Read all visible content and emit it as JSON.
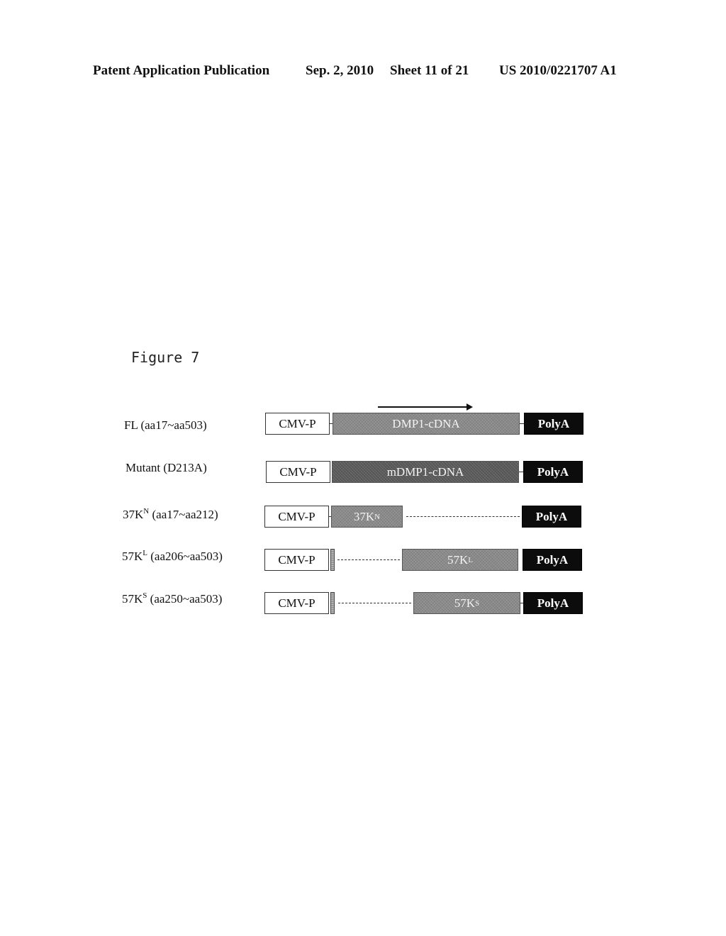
{
  "header": {
    "publication": "Patent Application Publication",
    "date": "Sep. 2, 2010",
    "sheet": "Sheet 11 of 21",
    "number": "US 2010/0221707 A1"
  },
  "figure": {
    "title": "Figure 7",
    "constructs": [
      {
        "name": "FL",
        "label_main": "FL (aa17~aa503)",
        "promoter": "CMV-P",
        "insert": "DMP1-cDNA",
        "insert_sup": "",
        "polya": "PolyA",
        "has_arrow": true
      },
      {
        "name": "Mutant",
        "label_main": "Mutant (D213A)",
        "promoter": "CMV-P",
        "insert": "mDMP1-cDNA",
        "insert_sup": "",
        "polya": "PolyA"
      },
      {
        "name": "37KN",
        "label_base": "37K",
        "label_sup": "N",
        "label_range": " (aa17~aa212)",
        "promoter": "CMV-P",
        "insert_base": "37K",
        "insert_sup": "N",
        "polya": "PolyA"
      },
      {
        "name": "57KL",
        "label_base": "57K",
        "label_sup": "L",
        "label_range": " (aa206~aa503)",
        "promoter": "CMV-P",
        "insert_base": "57K",
        "insert_sup": "L",
        "polya": "PolyA"
      },
      {
        "name": "57KS",
        "label_base": "57K",
        "label_sup": "S",
        "label_range": " (aa250~aa503)",
        "promoter": "CMV-P",
        "insert_base": "57K",
        "insert_sup": "S",
        "polya": "PolyA"
      }
    ]
  }
}
